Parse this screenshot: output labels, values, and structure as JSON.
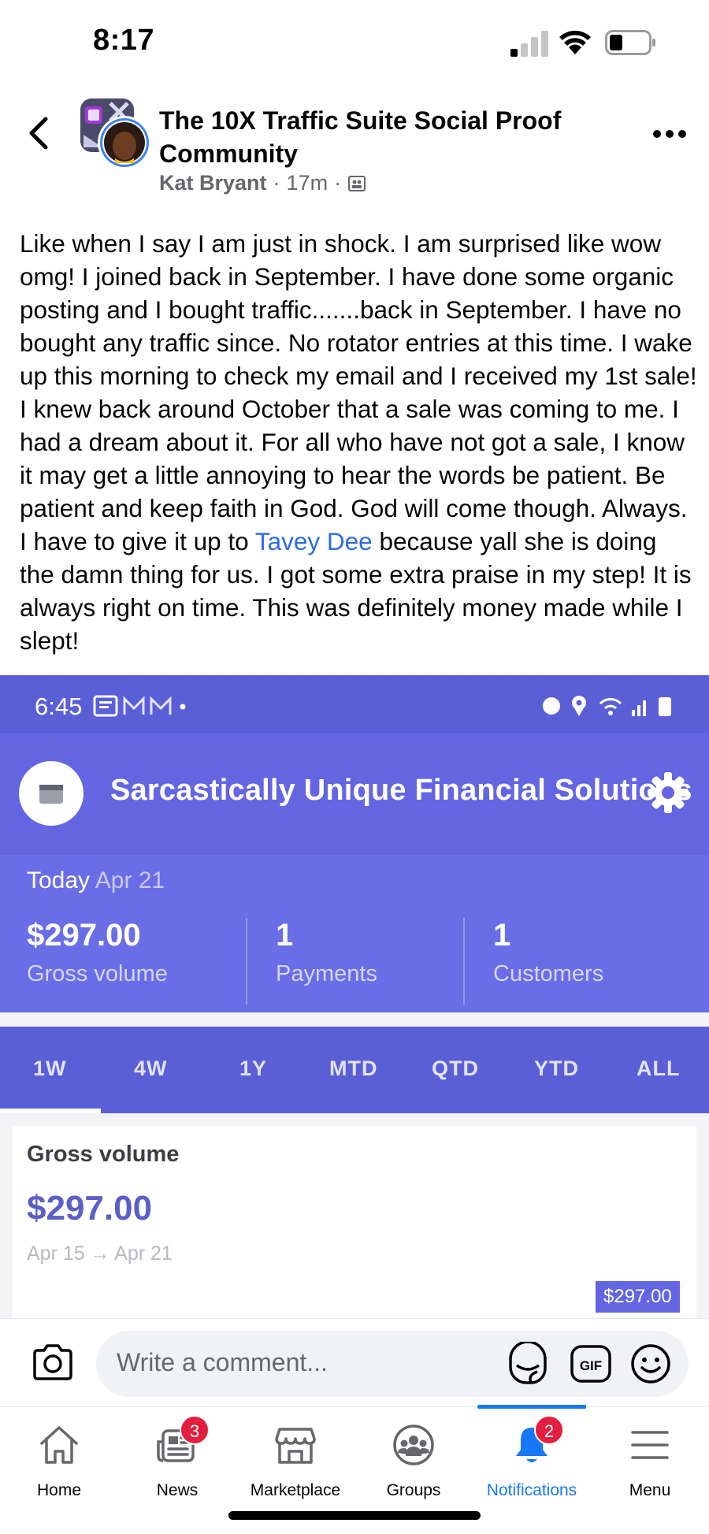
{
  "status_bar": {
    "time": "8:17"
  },
  "post": {
    "group_title": "The 10X Traffic Suite Social Proof Community",
    "author": "Kat Bryant",
    "time_ago": "17m",
    "body_before_mention": "Like when I say I am just in shock. I am surprised like wow omg! I joined back in September. I have done some organic posting and I bought traffic.......back in September. I have no bought any traffic since. No rotator entries at this time. I wake up this morning to check my email and I received my 1st sale! I knew back around October that a sale was coming to me. I had a dream about it. For all who have not got a sale, I know it may get a little annoying to hear the words be patient. Be patient and keep faith in God. God will come though. Always. I have to give it up to ",
    "mention": "Tavey Dee",
    "body_after_mention": " because yall she is doing the damn thing for us. I got some extra praise in my step! It is always right on time. This was definitely money made while I slept!"
  },
  "screenshot": {
    "time": "6:45",
    "store_name": "Sarcastically Unique Financial Solutions",
    "today_label": "Today",
    "today_date": "Apr 21",
    "stats": [
      {
        "value": "$297.00",
        "label": "Gross volume"
      },
      {
        "value": "1",
        "label": "Payments"
      },
      {
        "value": "1",
        "label": "Customers"
      }
    ],
    "tabs": [
      "1W",
      "4W",
      "1Y",
      "MTD",
      "QTD",
      "YTD",
      "ALL"
    ],
    "card": {
      "title": "Gross volume",
      "value": "$297.00",
      "range": "Apr 15 → Apr 21",
      "tooltip": "$297.00"
    },
    "colors": {
      "header": "#6366e0",
      "status": "#5b5fd6"
    }
  },
  "comment_bar": {
    "placeholder": "Write a comment..."
  },
  "nav": [
    {
      "label": "Home",
      "icon": "home-icon"
    },
    {
      "label": "News",
      "icon": "news-icon",
      "badge": "3"
    },
    {
      "label": "Marketplace",
      "icon": "marketplace-icon"
    },
    {
      "label": "Groups",
      "icon": "groups-icon"
    },
    {
      "label": "Notifications",
      "icon": "bell-icon",
      "badge": "2",
      "active": true
    },
    {
      "label": "Menu",
      "icon": "menu-icon"
    }
  ],
  "colors": {
    "accent": "#1877f2",
    "badge": "#e41e3f",
    "mention": "#2d6be0"
  }
}
